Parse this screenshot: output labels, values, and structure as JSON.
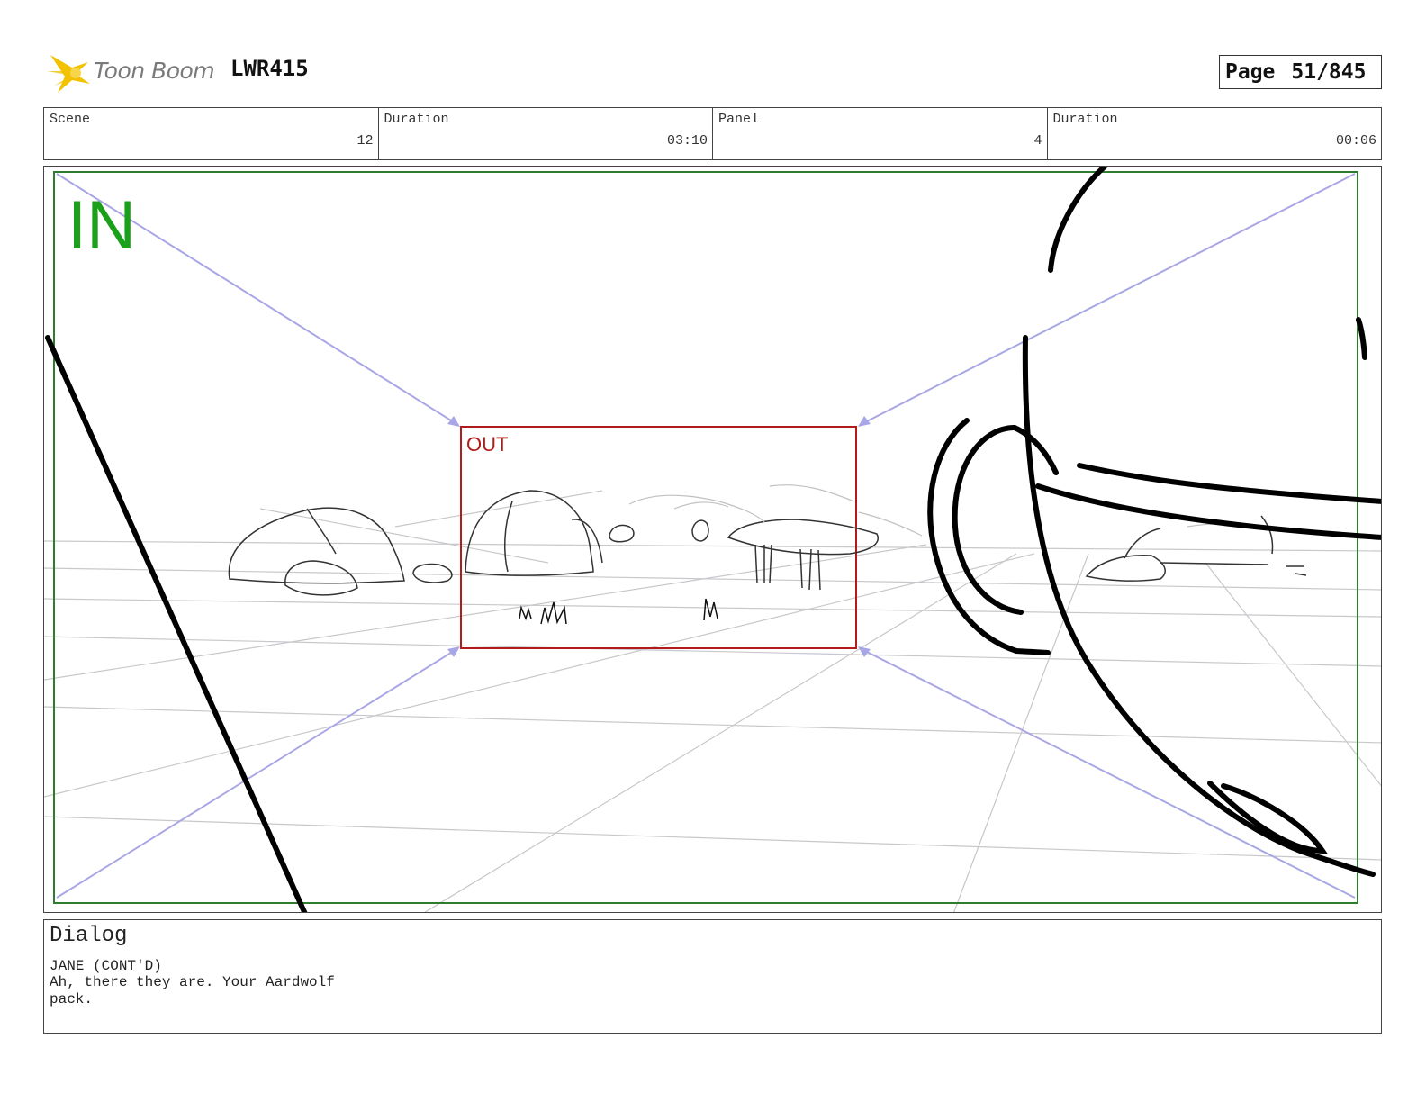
{
  "header": {
    "logo_text": "Toon Boom",
    "project_id": "LWR415",
    "page_label": "Page",
    "page_number": "51/845"
  },
  "info": {
    "scene_label": "Scene",
    "scene_value": "12",
    "scene_duration_label": "Duration",
    "scene_duration_value": "03:10",
    "panel_label": "Panel",
    "panel_value": "4",
    "panel_duration_label": "Duration",
    "panel_duration_value": "00:06"
  },
  "panel": {
    "in_label": "IN",
    "out_label": "OUT",
    "colors": {
      "in_frame": "#2e7d2e",
      "in_text": "#1aa01a",
      "out_frame": "#b01c1c",
      "camera_guides": "#a9a6e6",
      "grid": "#c8c8cc",
      "ink": "#000000"
    }
  },
  "dialog": {
    "title": "Dialog",
    "speaker": "JANE (CONT'D)",
    "line": "Ah, there they are. Your Aardwolf pack."
  }
}
